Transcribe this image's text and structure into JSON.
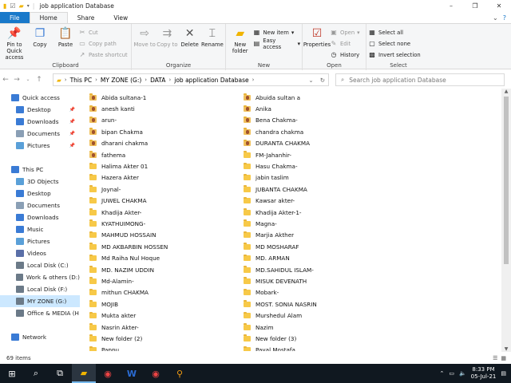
{
  "window": {
    "title": "job application Database",
    "controls": [
      "–",
      "❐",
      "✕"
    ]
  },
  "tabs": [
    {
      "label": "File"
    },
    {
      "label": "Home"
    },
    {
      "label": "Share"
    },
    {
      "label": "View"
    }
  ],
  "ribbon": {
    "clipboard": {
      "label": "Clipboard",
      "pin": "Pin to Quick access",
      "copy": "Copy",
      "paste": "Paste",
      "cut": "Cut",
      "copy_path": "Copy path",
      "paste_shortcut": "Paste shortcut"
    },
    "organize": {
      "label": "Organize",
      "move_to": "Move to",
      "copy_to": "Copy to",
      "delete": "Delete",
      "rename": "Rename"
    },
    "new": {
      "label": "New",
      "new_folder": "New folder",
      "new_item": "New item",
      "easy_access": "Easy access"
    },
    "open": {
      "label": "Open",
      "properties": "Properties",
      "open": "Open",
      "edit": "Edit",
      "history": "History"
    },
    "select": {
      "label": "Select",
      "select_all": "Select all",
      "select_none": "Select none",
      "invert": "Invert selection"
    }
  },
  "address": {
    "crumbs": [
      "This PC",
      "MY ZONE (G:)",
      "DATA",
      "job application Database"
    ],
    "search_placeholder": "Search job application Database"
  },
  "nav": [
    {
      "label": "Quick access",
      "icon": "star-icon",
      "pin": false
    },
    {
      "label": "Desktop",
      "icon": "desktop-icon",
      "pin": true
    },
    {
      "label": "Downloads",
      "icon": "download-icon",
      "pin": true
    },
    {
      "label": "Documents",
      "icon": "documents-icon",
      "pin": true
    },
    {
      "label": "Pictures",
      "icon": "pictures-icon",
      "pin": true
    },
    {
      "label": "",
      "icon": "",
      "pin": false
    },
    {
      "label": "This PC",
      "icon": "pc-icon",
      "pin": false
    },
    {
      "label": "3D Objects",
      "icon": "cube-icon",
      "pin": false
    },
    {
      "label": "Desktop",
      "icon": "desktop-icon",
      "pin": false
    },
    {
      "label": "Documents",
      "icon": "documents-icon",
      "pin": false
    },
    {
      "label": "Downloads",
      "icon": "download-icon",
      "pin": false
    },
    {
      "label": "Music",
      "icon": "music-icon",
      "pin": false
    },
    {
      "label": "Pictures",
      "icon": "pictures-icon",
      "pin": false
    },
    {
      "label": "Videos",
      "icon": "videos-icon",
      "pin": false
    },
    {
      "label": "Local Disk (C:)",
      "icon": "drive-icon",
      "pin": false
    },
    {
      "label": "Work & others  (D:)",
      "icon": "drive-icon",
      "pin": false
    },
    {
      "label": "Local Disk (F:)",
      "icon": "drive-icon",
      "pin": false
    },
    {
      "label": "MY ZONE (G:)",
      "icon": "drive-icon",
      "pin": false,
      "selected": true
    },
    {
      "label": "Office &  MEDIA (H",
      "icon": "drive-icon",
      "pin": false
    },
    {
      "label": "",
      "icon": "",
      "pin": false
    },
    {
      "label": "Network",
      "icon": "network-icon",
      "pin": false
    }
  ],
  "files_col1": [
    "Abida sultana-1",
    "anesh kanti",
    "arun-",
    "bipan Chakma",
    "dharani chakma",
    "fathema",
    "Halima Akter 01",
    "Hazera Akter",
    "Joynal-",
    "JUWEL CHAKMA",
    "Khadija Akter-",
    "KYATHUIMONG-",
    "MAHMUD HOSSAIN",
    "MD AKBARBIN HOSSEN",
    "Md Raiha Nul Hoque",
    "MD. NAZIM UDDIN",
    "Md-Alamin-",
    "mithun CHAKMA",
    "MOJIB",
    "Mukta akter",
    "Nasrin Akter-",
    "New folder (2)",
    "Pappu"
  ],
  "files_col2": [
    "Abuida sultan a",
    "Anika",
    "Bena Chakma-",
    "chandra chakma",
    "DURANTA CHAKMA",
    "FM-Jahanhir-",
    "Hasu Chakma-",
    "jabin taslim",
    "JUBANTA CHAKMA",
    "Kawsar akter-",
    "Khadija Akter-1-",
    "Magna-",
    "Marjia Akther",
    "MD MOSHARAF",
    "MD. ARMAN",
    "MD.SAHIDUL ISLAM-",
    "MISUK DEVENATH",
    "Mobark-",
    "MOST. SONIA NASRIN",
    "Murshedul Alam",
    "Nazim",
    "New folder (3)",
    "Payal Mostafa"
  ],
  "status": {
    "count": "69 items"
  },
  "taskbar": {
    "time": "8:33 PM",
    "date": "05-Jul-21"
  }
}
